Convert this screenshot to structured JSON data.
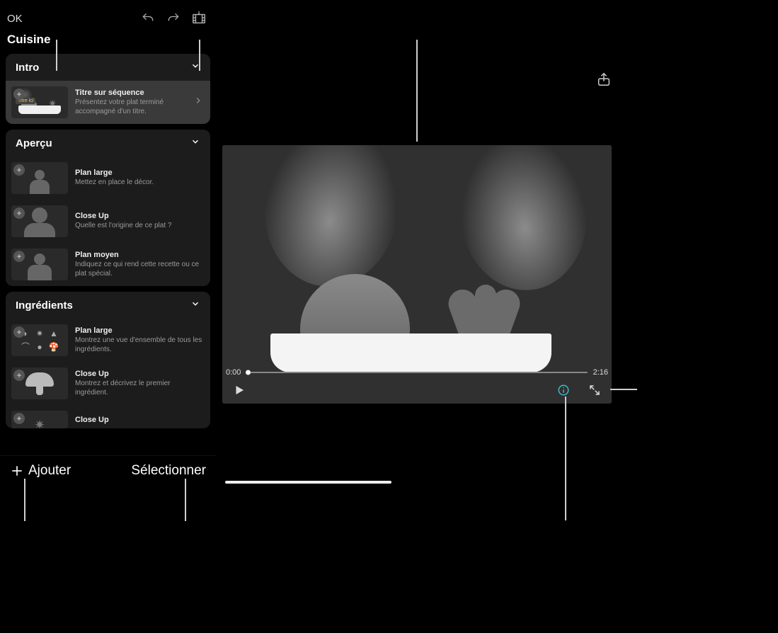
{
  "topbar": {
    "ok": "OK",
    "project_title": "Cuisine"
  },
  "sections": {
    "intro": {
      "header": "Intro",
      "shot1": {
        "title": "Titre sur séquence",
        "desc": "Présentez votre plat terminé accompagné d'un titre.",
        "thumb_label": "Titre ici"
      }
    },
    "apercu": {
      "header": "Aperçu",
      "shot1": {
        "title": "Plan large",
        "desc": "Mettez en place le décor."
      },
      "shot2": {
        "title": "Close Up",
        "desc": "Quelle est l'origine de ce plat ?"
      },
      "shot3": {
        "title": "Plan moyen",
        "desc": "Indiquez ce qui rend cette recette ou ce plat spécial."
      }
    },
    "ingredients": {
      "header": "Ingrédients",
      "shot1": {
        "title": "Plan large",
        "desc": "Montrez une vue d'ensemble de tous les ingrédients."
      },
      "shot2": {
        "title": "Close Up",
        "desc": "Montrez et décrivez le premier ingrédient."
      },
      "shot3": {
        "title": "Close Up"
      }
    }
  },
  "bottom_bar": {
    "add": "Ajouter",
    "select": "Sélectionner"
  },
  "player": {
    "current_time": "0:00",
    "duration": "2:16"
  },
  "icons": {
    "undo": "undo-icon",
    "redo": "redo-icon",
    "storyboard": "storyboard-icon",
    "share": "share-icon",
    "chevron_down": "chevron-down-icon",
    "chevron_right": "chevron-right-icon",
    "plus": "plus-icon",
    "play": "play-icon",
    "info": "info-icon",
    "fullscreen": "fullscreen-icon"
  }
}
